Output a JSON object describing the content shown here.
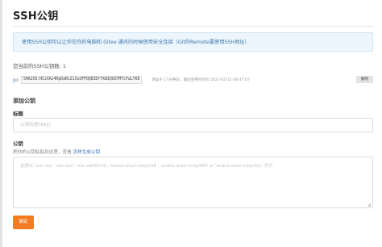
{
  "page": {
    "title": "SSH公钥"
  },
  "info": {
    "text": "使用SSH公钥可以让你在你的电脑和 Gitee 通讯的时候使用安全连接（Git的Remote要使用SSH地址）"
  },
  "keys": {
    "count_text": "您当前的SSH公钥数: 1",
    "items": [
      {
        "name": "pc",
        "fingerprint": "SHA256:HCzXAz4HpDaRxZiXzdFPQQDZDf7kWIQUU7M7cFwLY6E",
        "meta": "添加于 17分钟前，最后使用时间为 2022-05-11 09:47:07",
        "delete_label": "删除"
      }
    ]
  },
  "add_key": {
    "heading": "添加公钥",
    "title_label": "标题",
    "title_placeholder": "公钥标题(key)",
    "key_label": "公钥",
    "key_help_prefix": "把你的公钥粘贴到这里，查看 ",
    "key_help_link": "怎样生成公钥",
    "key_placeholder": "支持以 'ssh-rsa', 'ssh-dss', 'ssh-ed25519', 'ecdsa-sha2-nistp256', 'ecdsa-sha2-nistp384' or 'ecdsa-sha2-nistp521' 开头",
    "submit_label": "确定"
  },
  "colors": {
    "accent": "#f47b20",
    "info_bg": "#eef6fd",
    "info_text": "#3a76a8",
    "link": "#3d6fb6"
  }
}
